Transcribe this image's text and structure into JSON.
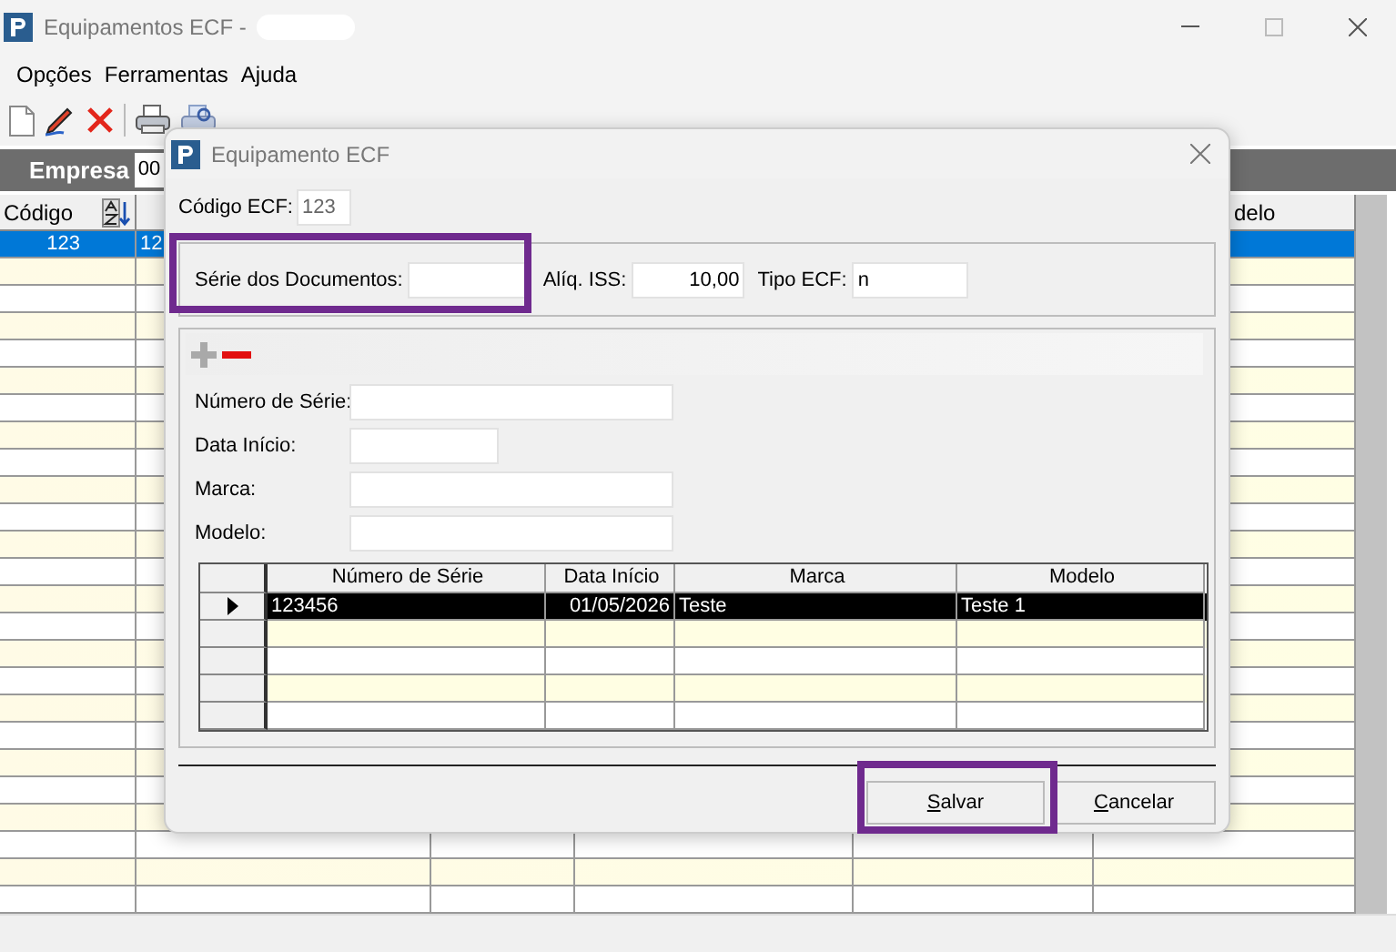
{
  "window": {
    "title": "Equipamentos ECF -"
  },
  "menu": [
    "Opções",
    "Ferramentas",
    "Ajuda"
  ],
  "filter": {
    "label": "Empresa",
    "value": "00"
  },
  "grid": {
    "columns": [
      {
        "label": "Código"
      },
      {
        "label": "delo"
      }
    ],
    "rows": [
      {
        "cells": [
          "123",
          "12"
        ],
        "selected": true
      }
    ]
  },
  "dialog": {
    "title": "Equipamento ECF",
    "code": {
      "label": "Código ECF:",
      "value": "123",
      "disabled": true
    },
    "header_fields": [
      {
        "label": "Série dos Documentos:"
      },
      {
        "label": "Alíq. ISS:",
        "value": "10,00"
      },
      {
        "label": "Tipo ECF:",
        "value": "n"
      }
    ],
    "form_fields": [
      {
        "label": "Número de Série:"
      },
      {
        "label": "Data Início:"
      },
      {
        "label": "Marca:"
      },
      {
        "label": "Modelo:"
      }
    ],
    "detail": {
      "columns": [
        "Número de Série",
        "Data Início",
        "Marca",
        "Modelo"
      ],
      "rows": [
        {
          "cells": [
            "123456",
            "01/05/2026",
            "Teste",
            "Teste 1"
          ],
          "selected": true
        }
      ]
    },
    "buttons": [
      {
        "label": "Salvar"
      },
      {
        "label": "Cancelar"
      }
    ]
  }
}
